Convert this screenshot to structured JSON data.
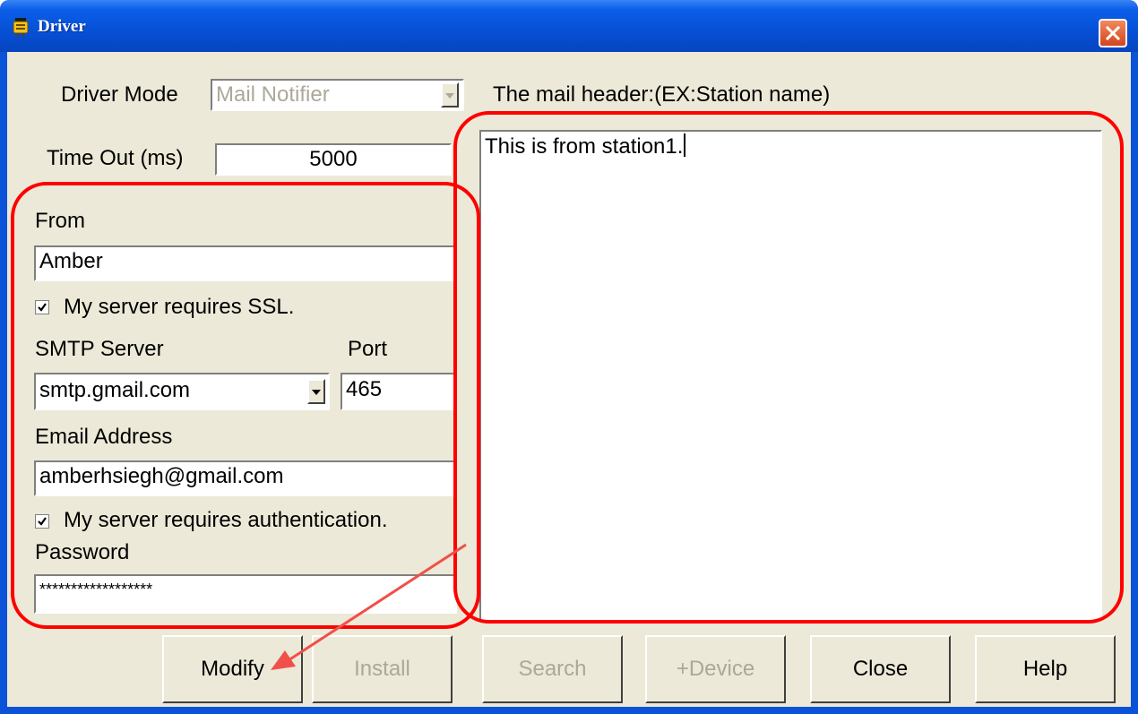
{
  "window": {
    "title": "Driver"
  },
  "form": {
    "driver_mode_label": "Driver Mode",
    "driver_mode_value": "Mail Notifier",
    "timeout_label": "Time Out (ms)",
    "timeout_value": "5000",
    "from_label": "From",
    "from_value": "Amber",
    "ssl_label": "My server requires SSL.",
    "ssl_checked": true,
    "smtp_label": "SMTP Server",
    "port_label": "Port",
    "smtp_value": "smtp.gmail.com",
    "port_value": "465",
    "email_label": "Email Address",
    "email_value": "amberhsiegh@gmail.com",
    "auth_label": "My server requires authentication.",
    "auth_checked": true,
    "password_label": "Password",
    "password_value": "******************"
  },
  "mail_header": {
    "label": "The mail header:(EX:Station name)",
    "value": "This is from station1."
  },
  "buttons": {
    "modify": "Modify",
    "install": "Install",
    "search": "Search",
    "device": "+Device",
    "close": "Close",
    "help": "Help"
  },
  "colors": {
    "titlebar": "#0650d6",
    "dialog_bg": "#ece9d8",
    "annotation": "#ff0000"
  },
  "icons": {
    "app": "driver-app-icon",
    "close": "close-x-icon",
    "check": "check-icon",
    "dropdown": "chevron-down-icon"
  }
}
